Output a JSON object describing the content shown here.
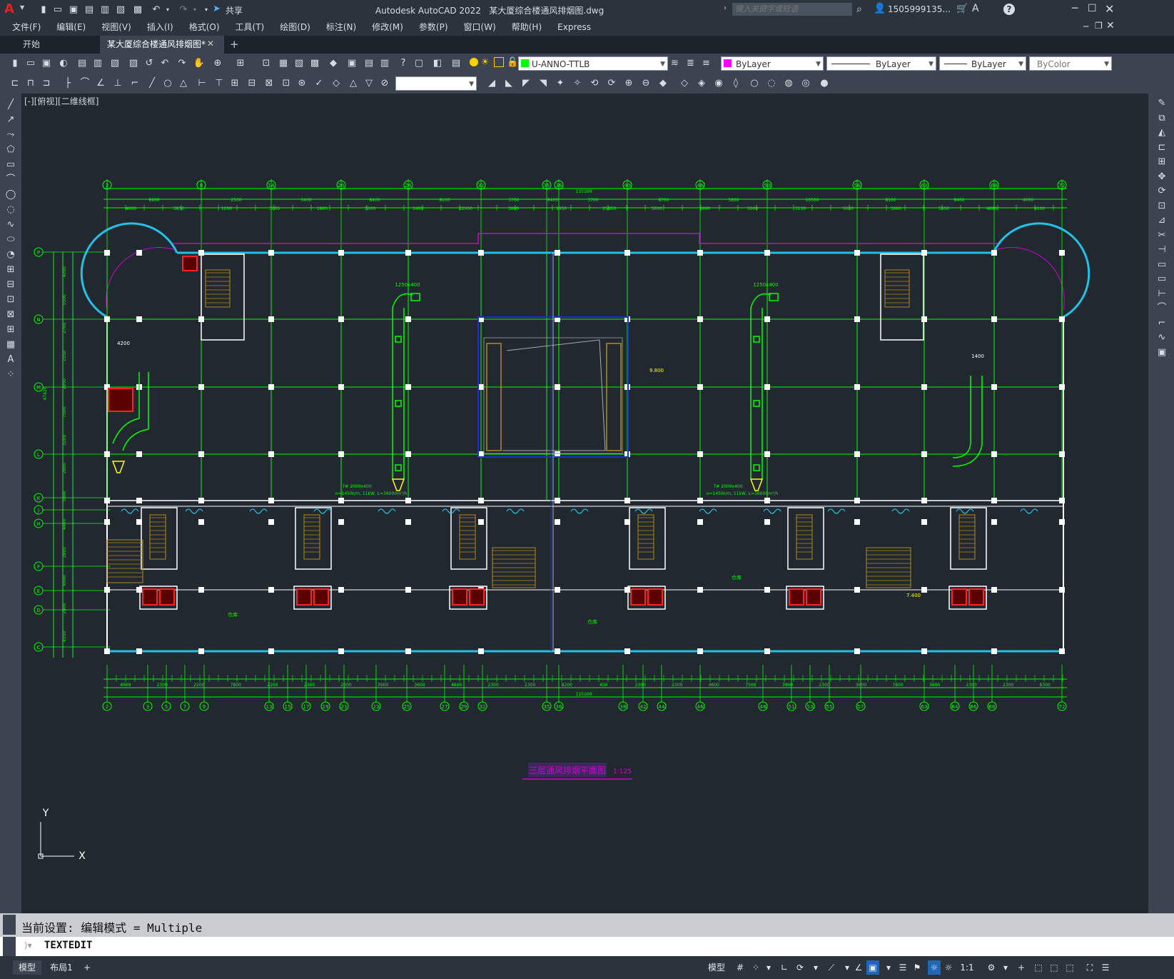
{
  "app": {
    "title": "Autodesk AutoCAD 2022",
    "filename": "某大厦综合楼通风排烟图.dwg",
    "logo": "A",
    "share_label": "共享",
    "search_placeholder": "键入关键字或短语",
    "user": "1505999135...",
    "help_icon": "?"
  },
  "menu": [
    "文件(F)",
    "编辑(E)",
    "视图(V)",
    "插入(I)",
    "格式(O)",
    "工具(T)",
    "绘图(D)",
    "标注(N)",
    "修改(M)",
    "参数(P)",
    "窗口(W)",
    "帮助(H)",
    "Express"
  ],
  "tabs": {
    "start": "开始",
    "active": "某大厦综合楼通风排烟图*",
    "add": "+"
  },
  "toolbar": {
    "layer": "U-ANNO-TTLB",
    "color": "ByLayer",
    "linetype": "ByLayer",
    "lineweight": "ByLayer",
    "plotstyle": "ByColor",
    "layer_color": "#00ff00",
    "color_swatch": "#ff00ff"
  },
  "viewport_label": "[-][俯视][二维线框]",
  "drawing": {
    "title": "三层通风排烟平面图",
    "scale": "1:125",
    "total_dim_top": "115100",
    "total_dim_bottom": "115100",
    "axis_top": [
      "2",
      "8",
      "14",
      "20",
      "26",
      "32",
      "35",
      "36",
      "40",
      "46",
      "50",
      "56",
      "63",
      "68",
      "72"
    ],
    "axis_bottom": [
      "2",
      "3",
      "5",
      "7",
      "9",
      "13",
      "15",
      "17",
      "19",
      "21",
      "23",
      "25",
      "27",
      "29",
      "32",
      "35",
      "36",
      "38",
      "42",
      "44",
      "46",
      "48",
      "51",
      "53",
      "55",
      "57",
      "63",
      "64",
      "66",
      "68",
      "72"
    ],
    "axis_left": [
      "P",
      "N",
      "M",
      "L",
      "K",
      "J",
      "H",
      "F",
      "E",
      "D",
      "C"
    ],
    "dims_top_row1": [
      "8900",
      "2500",
      "5400",
      "8400",
      "8100",
      "3700",
      "8400",
      "3700",
      "8700",
      "5800",
      "10500",
      "8100",
      "8400",
      "4000"
    ],
    "dims_top_row2": [
      "4000",
      "3850",
      "1200",
      "3000",
      "1800",
      "5000",
      "1600",
      "12000",
      "3000",
      "1650",
      "25650",
      "5000",
      "1600",
      "5000",
      "3150",
      "5000",
      "3000",
      "5000",
      "4600",
      "4100"
    ],
    "dims_bottom_row2": [
      "4900",
      "2300",
      "2200",
      "7800",
      "2200",
      "2300",
      "2300",
      "3900",
      "3600",
      "4600",
      "2300",
      "2300",
      "8200",
      "450",
      "2300",
      "2300",
      "4600",
      "7500",
      "3900",
      "2300",
      "3600",
      "7800",
      "3600",
      "2300",
      "2300",
      "8300"
    ],
    "dims_left": [
      "4200",
      "5500",
      "2700",
      "1550",
      "2950",
      "7500",
      "3200",
      "2800",
      "5000",
      "4400",
      "2800",
      "6000",
      "2800",
      "4550"
    ],
    "overall_left": "47420",
    "annotations": {
      "duct1": "1250x400",
      "duct2": "1250x400",
      "dim_4200": "4200",
      "dim_1400": "1400",
      "elev": "9.800",
      "elev2": "7.400",
      "fan1_tag": "7# 2000x400",
      "fan1_spec": "n=1450r/m, 11kW, L=36000m³/h",
      "fan2_tag": "7# 2000x400",
      "fan2_spec": "n=1450r/m, 11kW, L=36000m³/h",
      "room_label": "仓库"
    },
    "colors": {
      "grid": "#00ff00",
      "wall": "#ffffff",
      "outline": "#22c1e6",
      "duct": "#00ff00",
      "magenta": "#d400d4",
      "stair": "#b38a1a",
      "equip": "#ff2020",
      "atrium": "#1a2fd6",
      "yellow": "#ffff00"
    }
  },
  "ucs": {
    "x": "X",
    "y": "Y"
  },
  "command": {
    "history": "当前设置: 编辑模式 = Multiple",
    "current": "TEXTEDIT"
  },
  "status": {
    "layout_tabs": [
      "模型",
      "布局1",
      "+"
    ],
    "model_label": "模型",
    "scale": "1:1"
  }
}
